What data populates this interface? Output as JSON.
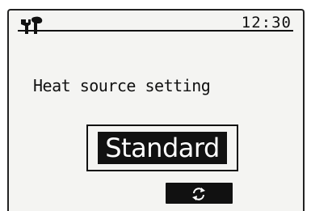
{
  "header": {
    "tool_icon": "wrench-icon",
    "clock": "12:30"
  },
  "main": {
    "setting_title": "Heat source setting",
    "selected_value": "Standard"
  },
  "function_buttons": [
    {
      "icon": "refresh-icon",
      "label": ""
    }
  ],
  "colors": {
    "screen_background": "#f4f4f2",
    "foreground": "#111111",
    "highlight_text": "#ffffff"
  }
}
